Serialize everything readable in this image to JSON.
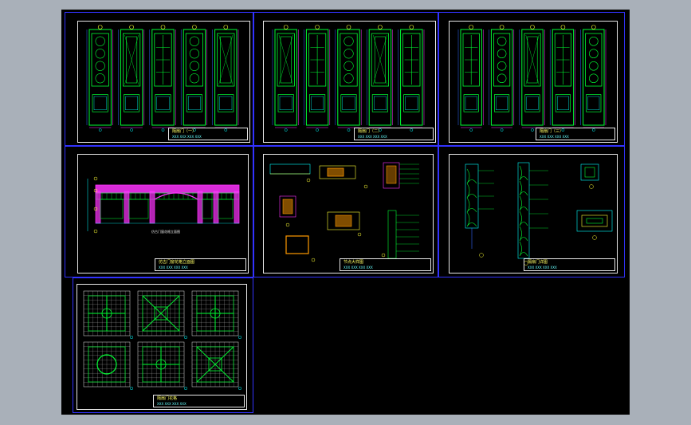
{
  "colors": {
    "background": "#a9b0b9",
    "canvas": "#000000",
    "sheet_border": "#3232ff",
    "frame": "#e9e9e9",
    "drawing_green": "#00ff33",
    "drawing_cyan": "#00ffff",
    "drawing_magenta": "#ff33ff",
    "drawing_yellow": "#ffff33",
    "drawing_orange": "#ff9900",
    "drawing_red": "#ff3333",
    "drawing_blue": "#3366ff"
  },
  "sheets": [
    {
      "id": "sheet-1",
      "title": "隔扇门（一）",
      "sub": "XXX  XXX  XXX  XXX"
    },
    {
      "id": "sheet-2",
      "title": "隔扇门（二）",
      "sub": "XXX  XXX  XXX  XXX"
    },
    {
      "id": "sheet-3",
      "title": "隔扇门（三）",
      "sub": "XXX  XXX  XXX  XXX"
    },
    {
      "id": "sheet-4",
      "title": "仿古门窗花格立面图",
      "sub": "XXX  XXX  XXX  XXX"
    },
    {
      "id": "sheet-5",
      "title": "节点大样图",
      "sub": "XXX  XXX  XXX  XXX"
    },
    {
      "id": "sheet-6",
      "title": "隔扇门详图",
      "sub": "XXX  XXX  XXX  XXX"
    },
    {
      "id": "sheet-7",
      "title": "隔扇门花格",
      "sub": "XXX  XXX  XXX  XXX"
    }
  ],
  "elevation_caption": "仿古门窗花格立面图"
}
